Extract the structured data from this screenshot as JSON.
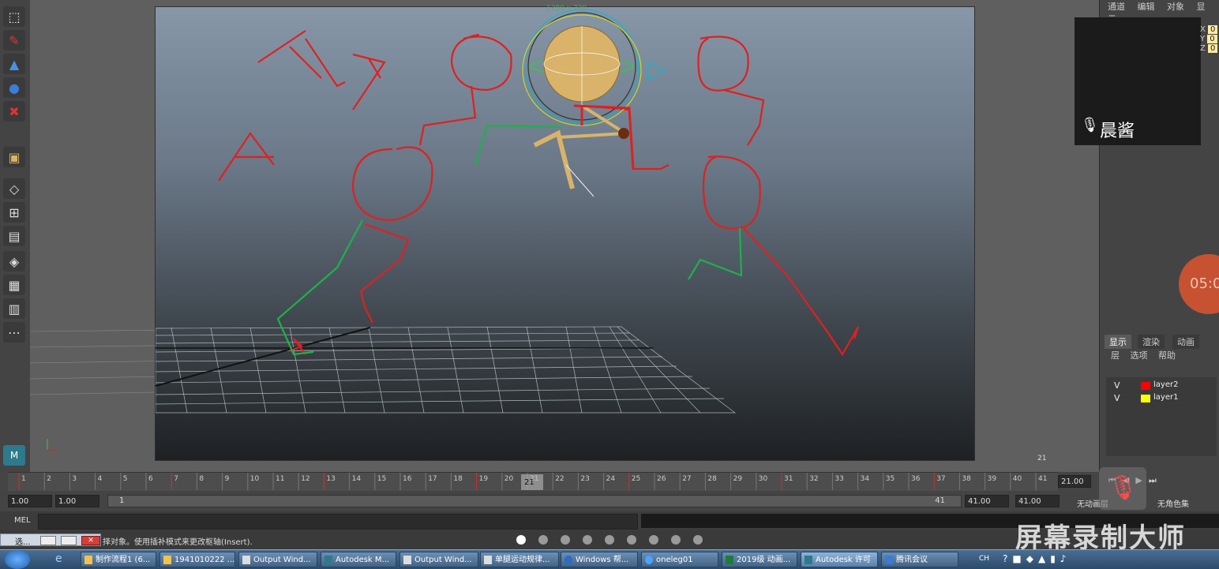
{
  "viewport": {
    "resolution_label": "1280 x 720",
    "frame_label": "21"
  },
  "right_panel": {
    "top_menu": [
      "通道",
      "编辑",
      "对象",
      "显示"
    ],
    "xyz_labels": [
      "X",
      "Y",
      "Z"
    ],
    "xyz_values": [
      "0",
      "0",
      "0"
    ],
    "overlay_name": "晨酱",
    "timer": "05:0",
    "tabs": [
      "显示",
      "渲染",
      "动画"
    ],
    "submenu": [
      "层",
      "选项",
      "帮助"
    ],
    "layers": [
      {
        "visible": "V",
        "name": "layer2",
        "color": "#ff0000"
      },
      {
        "visible": "V",
        "name": "layer1",
        "color": "#ffff00"
      }
    ]
  },
  "timeline": {
    "ticks": [
      "1",
      "2",
      "3",
      "4",
      "5",
      "6",
      "7",
      "8",
      "9",
      "10",
      "11",
      "12",
      "13",
      "14",
      "15",
      "16",
      "17",
      "18",
      "19",
      "20",
      "21",
      "22",
      "23",
      "24",
      "25",
      "26",
      "27",
      "28",
      "29",
      "30",
      "31",
      "32",
      "33",
      "34",
      "35",
      "36",
      "37",
      "38",
      "39",
      "40",
      "41"
    ],
    "current_frame": "21",
    "current_time": "21.00"
  },
  "range": {
    "start": "1.00",
    "start2": "1.00",
    "range_start": "1",
    "range_end": "41",
    "end": "41.00",
    "end2": "41.00",
    "anim_layer": "无动画层",
    "char_set": "无角色集"
  },
  "mel": {
    "label": "MEL"
  },
  "status": {
    "window_label": "选...",
    "text": "择对象。使用插补模式来更改枢轴(Insert)."
  },
  "watermark": "屏幕录制大师",
  "taskbar": {
    "items": [
      "制作流程1 (6...",
      "1941010222 ...",
      "Output Wind...",
      "Autodesk M...",
      "Output Wind...",
      "单腿运动规律...",
      "Windows 帮...",
      "oneleg01",
      "2019级 动画...",
      "Autodesk 许可",
      "腾讯会议"
    ],
    "tray_text": "CH"
  }
}
